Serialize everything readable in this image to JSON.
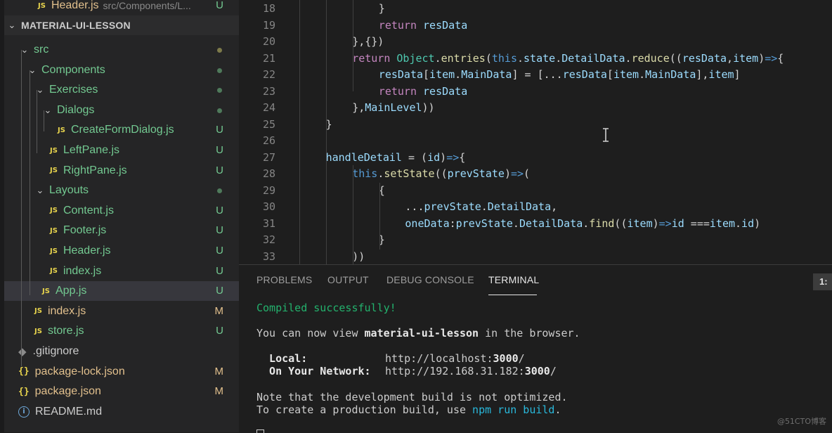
{
  "explorer": {
    "top_item": {
      "label": "Header.js",
      "path": "src/Components/L...",
      "status": "U"
    },
    "section_title": "MATERIAL-UI-LESSON",
    "items": [
      {
        "label": "src",
        "kind": "folder"
      },
      {
        "label": "Components",
        "kind": "folder"
      },
      {
        "label": "Exercises",
        "kind": "folder"
      },
      {
        "label": "Dialogs",
        "kind": "folder"
      },
      {
        "label": "CreateFormDialog.js",
        "kind": "js",
        "status": "U"
      },
      {
        "label": "LeftPane.js",
        "kind": "js",
        "status": "U"
      },
      {
        "label": "RightPane.js",
        "kind": "js",
        "status": "U"
      },
      {
        "label": "Layouts",
        "kind": "folder"
      },
      {
        "label": "Content.js",
        "kind": "js",
        "status": "U"
      },
      {
        "label": "Footer.js",
        "kind": "js",
        "status": "U"
      },
      {
        "label": "Header.js",
        "kind": "js",
        "status": "U"
      },
      {
        "label": "index.js",
        "kind": "js",
        "status": "U"
      },
      {
        "label": "App.js",
        "kind": "js",
        "status": "U"
      },
      {
        "label": "index.js",
        "kind": "js",
        "status": "M"
      },
      {
        "label": "store.js",
        "kind": "js",
        "status": "U"
      },
      {
        "label": ".gitignore",
        "kind": "git"
      },
      {
        "label": "package-lock.json",
        "kind": "json",
        "status": "M"
      },
      {
        "label": "package.json",
        "kind": "json",
        "status": "M"
      },
      {
        "label": "README.md",
        "kind": "info"
      }
    ],
    "js_badge": "JS",
    "json_badge": "{}",
    "info_badge": "i"
  },
  "editor": {
    "lines": [
      {
        "n": "18",
        "indent": 3,
        "tokens": [
          [
            "p",
            "}"
          ]
        ]
      },
      {
        "n": "19",
        "indent": 3,
        "tokens": [
          [
            "k",
            "return "
          ],
          [
            "v",
            "resData"
          ]
        ]
      },
      {
        "n": "20",
        "indent": 2,
        "tokens": [
          [
            "p",
            "},{})"
          ]
        ]
      },
      {
        "n": "21",
        "indent": 2,
        "tokens": [
          [
            "k",
            "return "
          ],
          [
            "c",
            "Object"
          ],
          [
            "p",
            "."
          ],
          [
            "f",
            "entries"
          ],
          [
            "p",
            "("
          ],
          [
            "b",
            "this"
          ],
          [
            "p",
            "."
          ],
          [
            "v",
            "state"
          ],
          [
            "p",
            "."
          ],
          [
            "v",
            "DetailData"
          ],
          [
            "p",
            "."
          ],
          [
            "f",
            "reduce"
          ],
          [
            "p",
            "(("
          ],
          [
            "v",
            "resData"
          ],
          [
            "p",
            ","
          ],
          [
            "v",
            "item"
          ],
          [
            "p",
            ")"
          ],
          [
            "b",
            "=>"
          ],
          [
            "p",
            "{"
          ]
        ]
      },
      {
        "n": "22",
        "indent": 3,
        "tokens": [
          [
            "v",
            "resData"
          ],
          [
            "p",
            "["
          ],
          [
            "v",
            "item"
          ],
          [
            "p",
            "."
          ],
          [
            "v",
            "MainData"
          ],
          [
            "p",
            "] = [..."
          ],
          [
            "v",
            "resData"
          ],
          [
            "p",
            "["
          ],
          [
            "v",
            "item"
          ],
          [
            "p",
            "."
          ],
          [
            "v",
            "MainData"
          ],
          [
            "p",
            "],"
          ],
          [
            "v",
            "item"
          ],
          [
            "p",
            "]"
          ]
        ]
      },
      {
        "n": "23",
        "indent": 3,
        "tokens": [
          [
            "k",
            "return "
          ],
          [
            "v",
            "resData"
          ]
        ]
      },
      {
        "n": "24",
        "indent": 2,
        "tokens": [
          [
            "p",
            "},"
          ],
          [
            "v",
            "MainLevel"
          ],
          [
            "p",
            "))"
          ]
        ]
      },
      {
        "n": "25",
        "indent": 1,
        "tokens": [
          [
            "p",
            "}"
          ]
        ]
      },
      {
        "n": "26",
        "indent": 0,
        "tokens": []
      },
      {
        "n": "27",
        "indent": 1,
        "tokens": [
          [
            "v",
            "handleDetail"
          ],
          [
            "p",
            " = ("
          ],
          [
            "v",
            "id"
          ],
          [
            "p",
            ")"
          ],
          [
            "b",
            "=>"
          ],
          [
            "p",
            "{"
          ]
        ]
      },
      {
        "n": "28",
        "indent": 2,
        "tokens": [
          [
            "b",
            "this"
          ],
          [
            "p",
            "."
          ],
          [
            "f",
            "setState"
          ],
          [
            "p",
            "(("
          ],
          [
            "v",
            "prevState"
          ],
          [
            "p",
            ")"
          ],
          [
            "b",
            "=>"
          ],
          [
            "p",
            "("
          ]
        ]
      },
      {
        "n": "29",
        "indent": 3,
        "tokens": [
          [
            "p",
            "{"
          ]
        ]
      },
      {
        "n": "30",
        "indent": 4,
        "tokens": [
          [
            "p",
            "..."
          ],
          [
            "v",
            "prevState"
          ],
          [
            "p",
            "."
          ],
          [
            "v",
            "DetailData"
          ],
          [
            "p",
            ","
          ]
        ]
      },
      {
        "n": "31",
        "indent": 4,
        "tokens": [
          [
            "v",
            "oneData"
          ],
          [
            "p",
            ":"
          ],
          [
            "v",
            "prevState"
          ],
          [
            "p",
            "."
          ],
          [
            "v",
            "DetailData"
          ],
          [
            "p",
            "."
          ],
          [
            "f",
            "find"
          ],
          [
            "p",
            "(("
          ],
          [
            "v",
            "item"
          ],
          [
            "p",
            ")"
          ],
          [
            "b",
            "=>"
          ],
          [
            "v",
            "id"
          ],
          [
            "p",
            " ==="
          ],
          [
            "v",
            "item"
          ],
          [
            "p",
            "."
          ],
          [
            "v",
            "id"
          ],
          [
            "p",
            ")"
          ]
        ]
      },
      {
        "n": "32",
        "indent": 3,
        "tokens": [
          [
            "p",
            "}"
          ]
        ]
      },
      {
        "n": "33",
        "indent": 2,
        "tokens": [
          [
            "p",
            "))"
          ]
        ]
      }
    ]
  },
  "panel": {
    "tabs": [
      "PROBLEMS",
      "OUTPUT",
      "DEBUG CONSOLE",
      "TERMINAL"
    ],
    "active_tab": "TERMINAL",
    "terminal_selector": "1:",
    "terminal": {
      "compiled": "Compiled successfully!",
      "view_prefix": "You can now view ",
      "app_name": "material-ui-lesson",
      "view_suffix": " in the browser.",
      "local_label": "  Local:",
      "local_url_prefix": "http://localhost:",
      "local_port": "3000",
      "network_label": "  On Your Network:",
      "network_url_prefix": "http://192.168.31.182:",
      "network_port": "3000",
      "note1": "Note that the development build is not optimized.",
      "note2_prefix": "To create a production build, use ",
      "note2_cmd": "npm run build",
      "note2_suffix": "."
    }
  },
  "watermark": "@51CTO博客"
}
